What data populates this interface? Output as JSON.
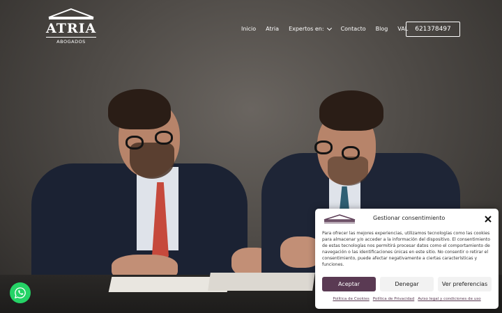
{
  "logo": {
    "name": "ATRIA",
    "subtitle": "ABOGADOS"
  },
  "nav": {
    "items": [
      "Inicio",
      "Atria",
      "Expertos en:",
      "Contacto",
      "Blog",
      "VAL"
    ],
    "phone": "621378497"
  },
  "consent": {
    "title": "Gestionar consentimiento",
    "body": "Para ofrecer las mejores experiencias, utilizamos tecnologías como las cookies para almacenar y/o acceder a la información del dispositivo. El consentimiento de estas tecnologías nos permitirá procesar datos como el comportamiento de navegación o las identificaciones únicas en este sitio. No consentir o retirar el consentimiento, puede afectar negativamente a ciertas características y funciones.",
    "accept": "Aceptar",
    "deny": "Denegar",
    "preferences": "Ver preferencias",
    "links": [
      "Política de Cookies",
      "Política de Privacidad",
      "Aviso legal y condiciones de uso"
    ],
    "accent_color": "#5a3a53"
  },
  "whatsapp": {
    "icon": "whatsapp-icon",
    "color": "#25d366"
  }
}
